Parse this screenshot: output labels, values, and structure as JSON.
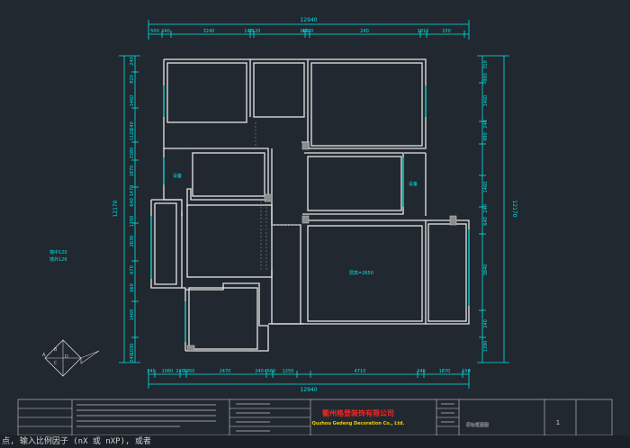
{
  "colors": {
    "background": "#212830",
    "wall": "#e6e6e6",
    "dimension": "#00e6e6",
    "wall_accent": "#00b4b4",
    "title_red": "#ff2222",
    "title_yellow": "#f0d000"
  },
  "dimensions": {
    "top_total": "12940",
    "top_segments": [
      "500",
      "240",
      "3240",
      "140",
      "2120",
      "150",
      "4530",
      "240",
      "1810",
      "150"
    ],
    "bottom_total": "12940",
    "bottom_segments": [
      "240",
      "1060",
      "240",
      "3950",
      "2470",
      "240",
      "4560",
      "1250",
      "4710",
      "240",
      "1870",
      "150"
    ],
    "left_total": "12170",
    "left_segments": [
      "240",
      "820",
      "1460",
      "240",
      "1120",
      "2380",
      "1870",
      "1470",
      "640",
      "1700",
      "2630",
      "670",
      "660",
      "1460",
      "1030",
      "240"
    ],
    "right_total": "12170",
    "right_segments": [
      "310",
      "880",
      "1460",
      "240",
      "990",
      "1460",
      "240",
      "640",
      "3840",
      "240",
      "1390"
    ]
  },
  "room_labels": {
    "balcony_left": "设备",
    "balcony_right": "设备",
    "main_room": "层高=2650"
  },
  "wall_notes": [
    "墙中120",
    "墙外126"
  ],
  "compass_letters": [
    "A",
    "B",
    "C",
    "D"
  ],
  "title_block": {
    "company_cn": "衢州格登装饰有限公司",
    "company_en": "Quzhou Gedeng Decoration Co., Ltd.",
    "drawing_title": "原始框图图",
    "sheet_number": "1"
  },
  "command_line": "点, 输入比例因子 (nX 或 nXP), 或者"
}
